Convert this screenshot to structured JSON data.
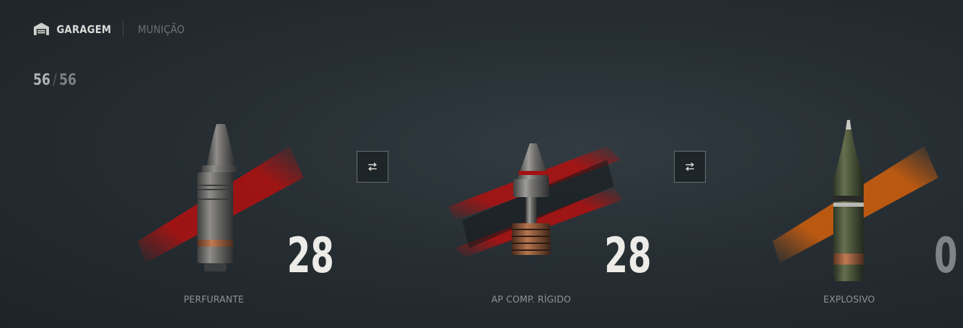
{
  "header": {
    "icon": "garage-icon",
    "garage_label": "GARAGEM",
    "ammo_label": "MUNIÇÃO"
  },
  "capacity": {
    "current": "56",
    "separator": "/",
    "max": "56"
  },
  "shells": [
    {
      "name": "PERFURANTE",
      "quantity": "28",
      "stripe_color": "#b3100f",
      "icon": "ap-shell-icon"
    },
    {
      "name": "AP COMP. RÍGIDO",
      "quantity": "28",
      "stripe_color": "#b3100f",
      "icon": "apcr-shell-icon"
    },
    {
      "name": "EXPLOSIVO",
      "quantity": "0",
      "stripe_color": "#d4600c",
      "icon": "he-shell-icon"
    }
  ],
  "swap_buttons": [
    {
      "icon": "swap-arrows-icon"
    },
    {
      "icon": "swap-arrows-icon"
    }
  ]
}
